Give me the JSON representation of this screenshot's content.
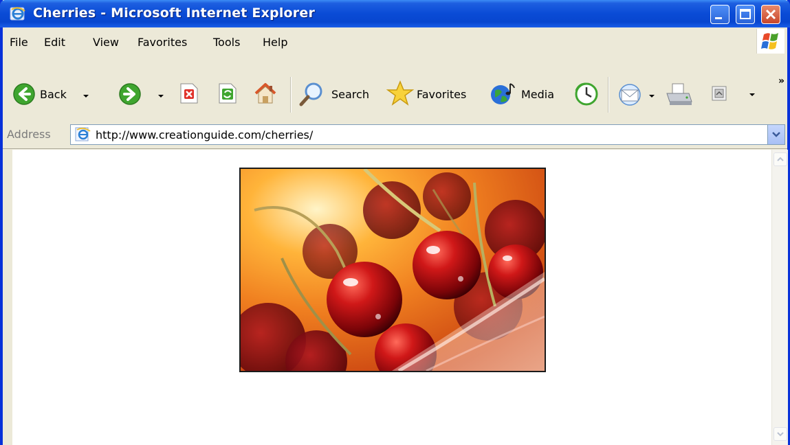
{
  "window": {
    "title": "Cherries - Microsoft Internet Explorer"
  },
  "menu": {
    "items": [
      "File",
      "Edit",
      "View",
      "Favorites",
      "Tools",
      "Help"
    ]
  },
  "toolbar": {
    "back_label": "Back",
    "search_label": "Search",
    "favorites_label": "Favorites",
    "media_label": "Media",
    "more_glyph": "»"
  },
  "address": {
    "label": "Address",
    "url": "http://www.creationguide.com/cherries/"
  },
  "content": {
    "image_name": "cherries-photo"
  },
  "colors": {
    "title_bar": "#0a4bd6",
    "chrome": "#ece9d8",
    "close_button": "#c8462a"
  }
}
